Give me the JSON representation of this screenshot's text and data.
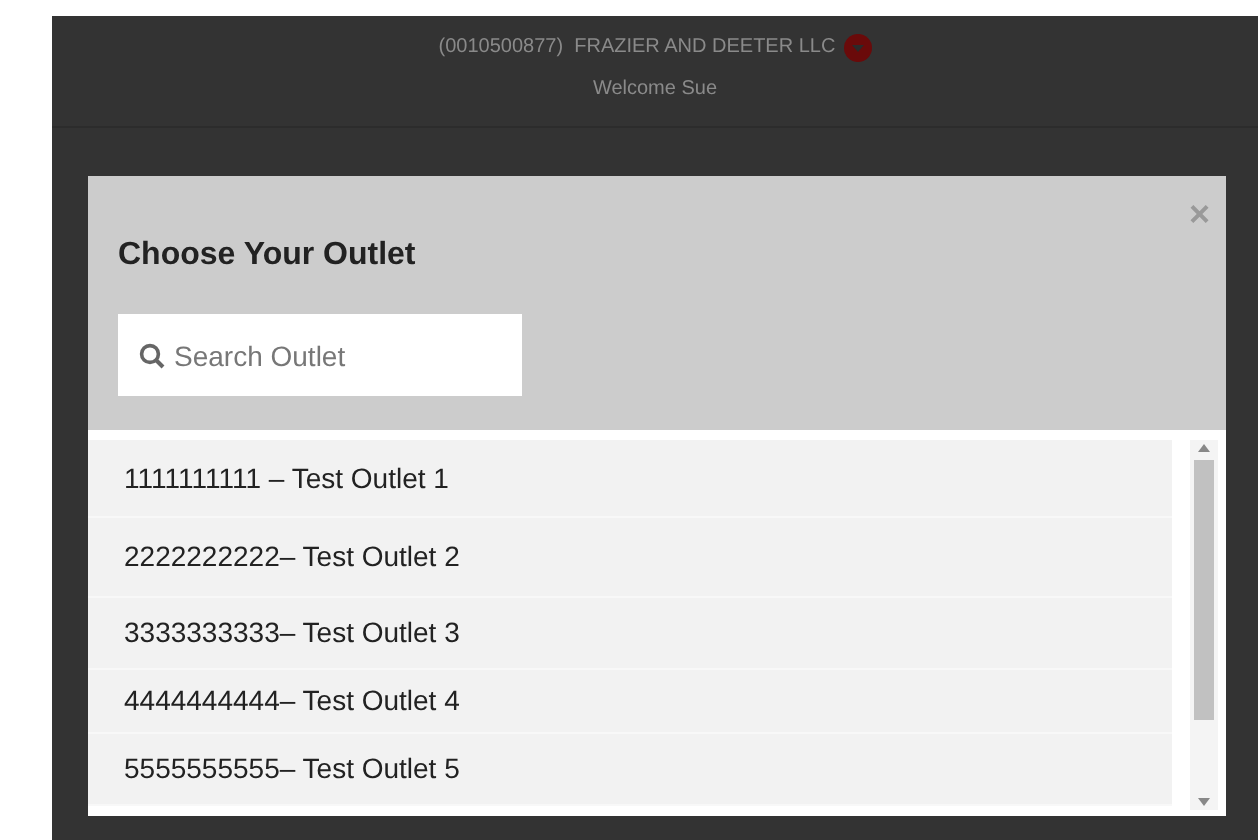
{
  "header": {
    "account": "(0010500877)  FRAZIER AND DEETER LLC",
    "welcome": "Welcome Sue"
  },
  "modal": {
    "title": "Choose Your Outlet",
    "close": "×",
    "search": {
      "placeholder": "Search Outlet"
    },
    "outlets": [
      {
        "label": "1111111111 – Test Outlet 1"
      },
      {
        "label": "2222222222– Test Outlet 2"
      },
      {
        "label": "3333333333– Test Outlet 3"
      },
      {
        "label": "4444444444– Test Outlet 4"
      },
      {
        "label": "5555555555– Test Outlet 5"
      }
    ]
  }
}
